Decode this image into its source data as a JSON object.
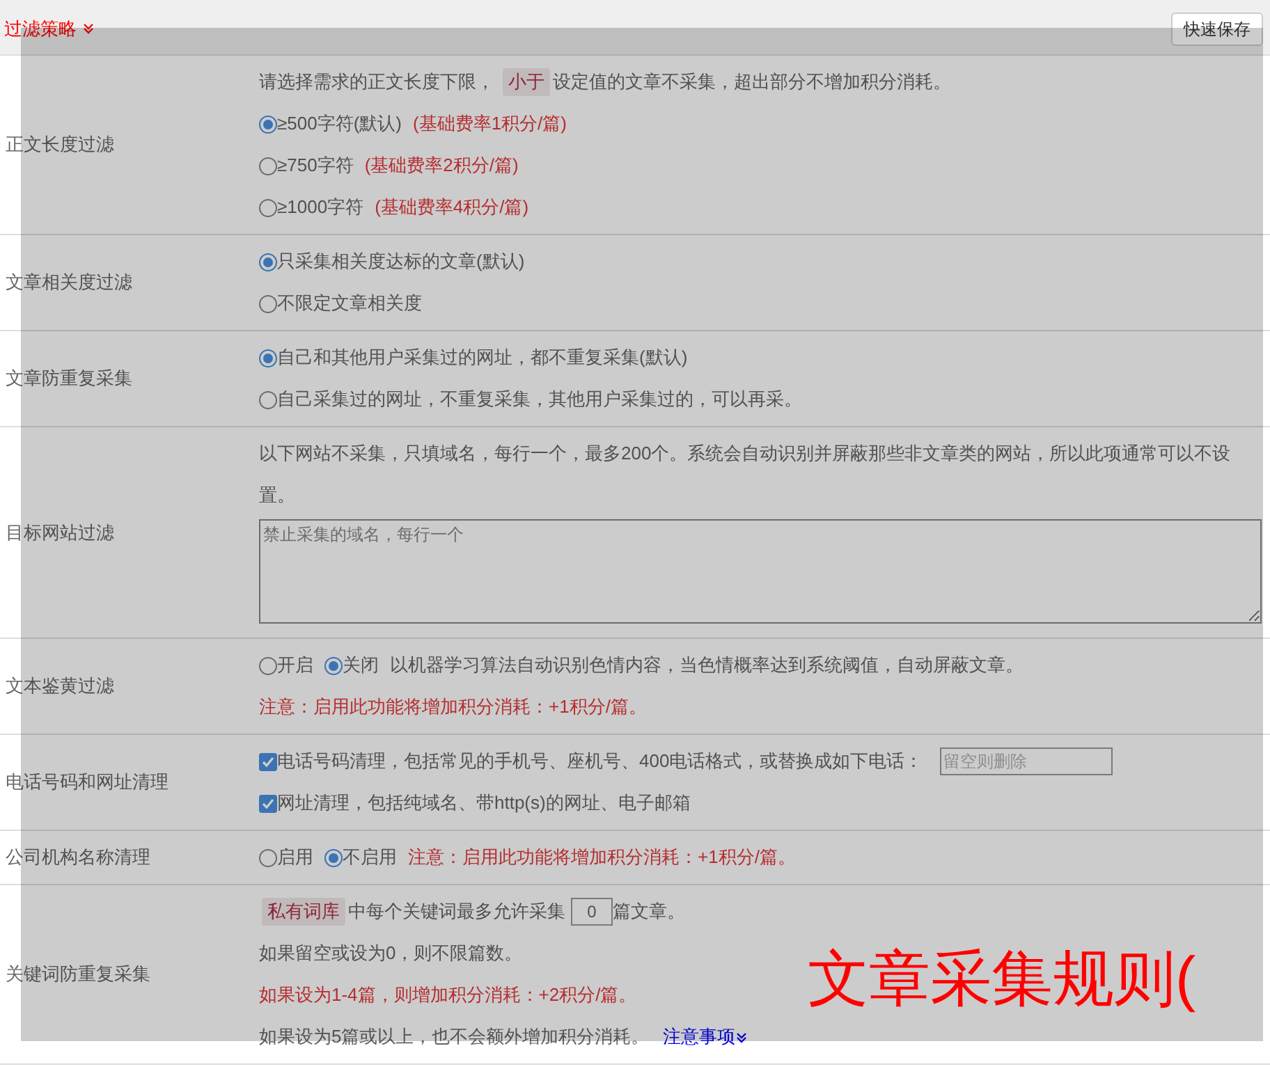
{
  "header": {
    "title": "过滤策略",
    "save_button": "快速保存"
  },
  "sections": [
    {
      "label": "正文长度过滤",
      "lines": [
        [
          {
            "kind": "text",
            "text": "请选择需求的正文长度下限，"
          },
          {
            "kind": "tag",
            "text": "小于"
          },
          {
            "kind": "text",
            "text": "设定值的文章不采集，超出部分不增加积分消耗。"
          }
        ],
        [
          {
            "kind": "radio",
            "text": "≥500字符(默认)",
            "selected": true
          },
          {
            "kind": "red",
            "text": "(基础费率1积分/篇)"
          }
        ],
        [
          {
            "kind": "radio",
            "text": "≥750字符",
            "selected": false
          },
          {
            "kind": "red",
            "text": "(基础费率2积分/篇)"
          }
        ],
        [
          {
            "kind": "radio",
            "text": "≥1000字符",
            "selected": false
          },
          {
            "kind": "red",
            "text": "(基础费率4积分/篇)"
          }
        ]
      ]
    },
    {
      "label": "文章相关度过滤",
      "lines": [
        [
          {
            "kind": "radio",
            "text": "只采集相关度达标的文章(默认)",
            "selected": true
          }
        ],
        [
          {
            "kind": "radio",
            "text": "不限定文章相关度",
            "selected": false
          }
        ]
      ]
    },
    {
      "label": "文章防重复采集",
      "lines": [
        [
          {
            "kind": "radio",
            "text": "自己和其他用户采集过的网址，都不重复采集(默认)",
            "selected": true
          }
        ],
        [
          {
            "kind": "radio",
            "text": "自己采集过的网址，不重复采集，其他用户采集过的，可以再采。",
            "selected": false
          }
        ]
      ]
    },
    {
      "label": "目标网站过滤",
      "lines": [
        [
          {
            "kind": "text",
            "text": "以下网站不采集，只填域名，每行一个，最多200个。系统会自动识别并屏蔽那些非文章类的网站，所以此项通常可以不设置。"
          }
        ],
        [
          {
            "kind": "textarea",
            "placeholder": "禁止采集的域名，每行一个"
          }
        ]
      ]
    },
    {
      "label": "文本鉴黄过滤",
      "lines": [
        [
          {
            "kind": "radio",
            "text": "开启",
            "selected": false
          },
          {
            "kind": "radio",
            "text": "关闭",
            "selected": true
          },
          {
            "kind": "text",
            "text": "以机器学习算法自动识别色情内容，当色情概率达到系统阈值，自动屏蔽文章。"
          }
        ],
        [
          {
            "kind": "red",
            "text": "注意：启用此功能将增加积分消耗：+1积分/篇。"
          }
        ]
      ]
    },
    {
      "label": "电话号码和网址清理",
      "lines": [
        [
          {
            "kind": "checkbox",
            "text": "电话号码清理，包括常见的手机号、座机号、400电话格式，或替换成如下电话：",
            "checked": true
          },
          {
            "kind": "input",
            "placeholder": "留空则删除"
          }
        ],
        [
          {
            "kind": "checkbox",
            "text": "网址清理，包括纯域名、带http(s)的网址、电子邮箱",
            "checked": true
          }
        ]
      ]
    },
    {
      "label": "公司机构名称清理",
      "lines": [
        [
          {
            "kind": "radio",
            "text": "启用",
            "selected": false
          },
          {
            "kind": "radio",
            "text": "不启用",
            "selected": true
          },
          {
            "kind": "red",
            "text": "注意：启用此功能将增加积分消耗：+1积分/篇。"
          }
        ]
      ]
    },
    {
      "label": "关键词防重复采集",
      "lines": [
        [
          {
            "kind": "tag",
            "text": "私有词库"
          },
          {
            "kind": "text",
            "text": "中每个关键词最多允许采集"
          },
          {
            "kind": "input",
            "value": "0"
          },
          {
            "kind": "text",
            "text": "篇文章。"
          }
        ],
        [
          {
            "kind": "text",
            "text": "如果留空或设为0，则不限篇数。"
          }
        ],
        [
          {
            "kind": "red",
            "text": "如果设为1-4篇，则增加积分消耗：+2积分/篇。"
          }
        ],
        [
          {
            "kind": "text",
            "text": "如果设为5篇或以上，也不会额外增加积分消耗。"
          },
          {
            "kind": "link",
            "text": "注意事项"
          }
        ]
      ]
    }
  ],
  "overlay": {
    "text": "文章采集规则("
  }
}
